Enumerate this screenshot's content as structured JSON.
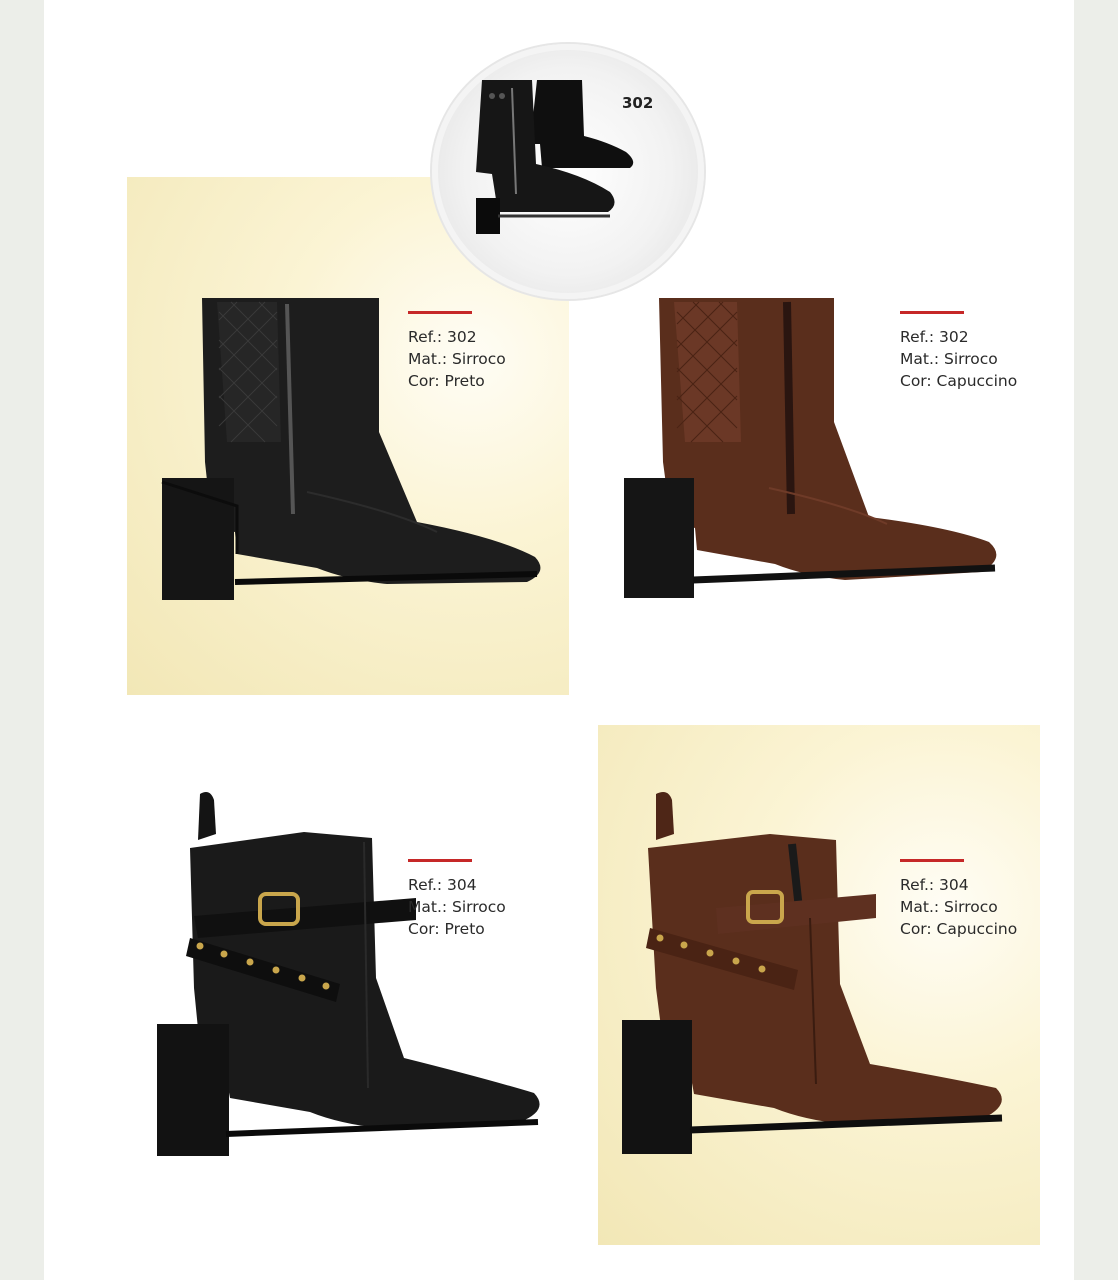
{
  "featured": {
    "ref_number": "302"
  },
  "products": [
    {
      "ref": "Ref.: 302",
      "material": "Mat.: Sirroco",
      "color": "Cor: Preto",
      "color_hex": "#1a1a1a",
      "style": "quilted"
    },
    {
      "ref": "Ref.: 302",
      "material": "Mat.: Sirroco",
      "color": "Cor: Capuccino",
      "color_hex": "#5a2e1c",
      "style": "quilted"
    },
    {
      "ref": "Ref.: 304",
      "material": "Mat.: Sirroco",
      "color": "Cor: Preto",
      "color_hex": "#1a1a1a",
      "style": "buckle"
    },
    {
      "ref": "Ref.: 304",
      "material": "Mat.: Sirroco",
      "color": "Cor: Capuccino",
      "color_hex": "#5a2e1c",
      "style": "buckle"
    }
  ],
  "colors": {
    "accent_bar": "#c62828",
    "panel": "#f2e7b6",
    "background": "#eceee9"
  }
}
